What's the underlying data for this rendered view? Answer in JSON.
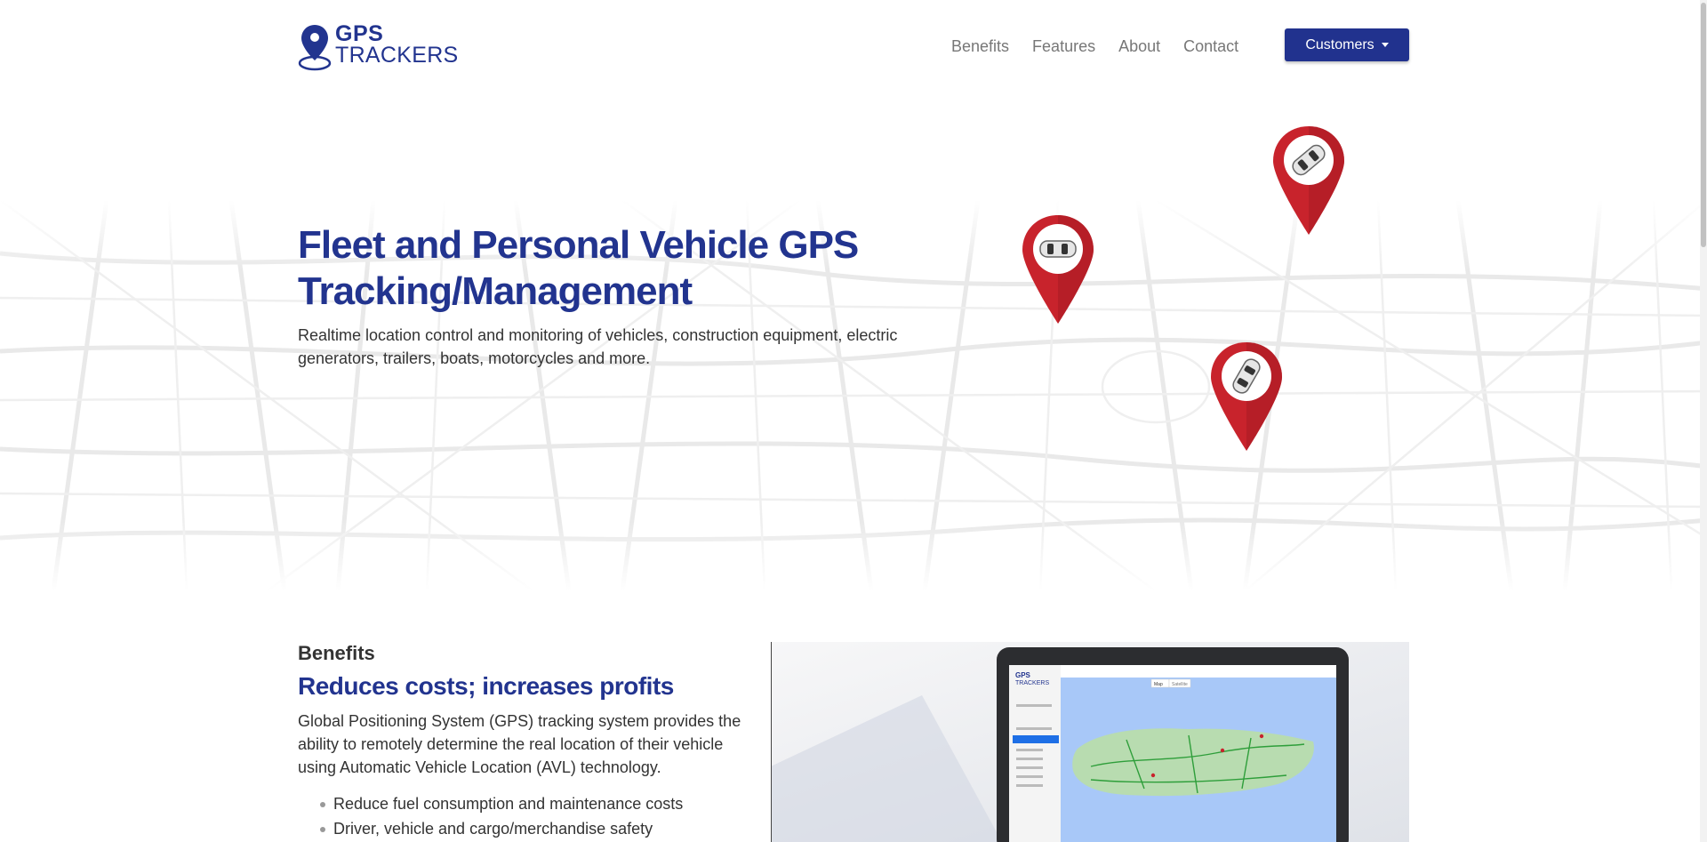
{
  "brand": {
    "line1": "GPS",
    "line2": "TRACKERS",
    "color": "#22348f"
  },
  "nav": {
    "links": [
      "Benefits",
      "Features",
      "About",
      "Contact"
    ],
    "customers_label": "Customers"
  },
  "hero": {
    "title_line1": "Fleet and Personal Vehicle GPS",
    "title_line2": "Tracking/Management",
    "subtitle_line1": "Realtime location control and monitoring of vehicles, construction equipment, electric",
    "subtitle_line2": "generators, trailers, boats, motorcycles and more."
  },
  "benefits": {
    "label": "Benefits",
    "title": "Reduces costs; increases profits",
    "text_lines": [
      "Global Positioning System (GPS) tracking system provides the",
      "ability to remotely determine the real location of their vehicle",
      "using Automatic Vehicle Location (AVL) technology."
    ],
    "items": [
      "Reduce fuel consumption and maintenance costs",
      "Driver, vehicle and cargo/merchandise safety"
    ]
  },
  "screen": {
    "logo_line1": "GPS",
    "logo_line2": "TRACKERS",
    "tab_map": "Map",
    "tab_satellite": "Satellite"
  },
  "colors": {
    "pin_red": "#c8232c",
    "brand_blue": "#21328e",
    "map_water": "#a8c8f8",
    "map_land": "#b8dcb0"
  }
}
